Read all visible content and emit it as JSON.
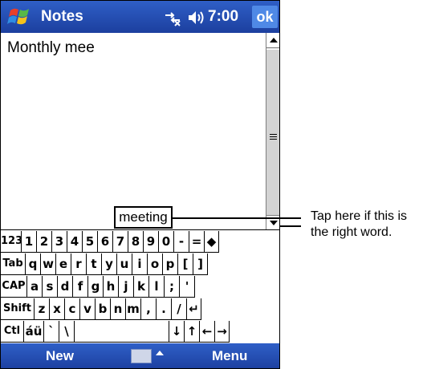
{
  "titlebar": {
    "app_title": "Notes",
    "time": "7:00",
    "ok_label": "ok"
  },
  "note": {
    "text": "Monthly mee"
  },
  "suggestion": {
    "word": "meeting"
  },
  "keyboard": {
    "rows": [
      [
        "123",
        "1",
        "2",
        "3",
        "4",
        "5",
        "6",
        "7",
        "8",
        "9",
        "0",
        "-",
        "=",
        "◆"
      ],
      [
        "Tab",
        "q",
        "w",
        "e",
        "r",
        "t",
        "y",
        "u",
        "i",
        "o",
        "p",
        "[",
        "]"
      ],
      [
        "CAP",
        "a",
        "s",
        "d",
        "f",
        "g",
        "h",
        "j",
        "k",
        "l",
        ";",
        "'"
      ],
      [
        "Shift",
        "z",
        "x",
        "c",
        "v",
        "b",
        "n",
        "m",
        ",",
        ".",
        "/",
        "↵"
      ],
      [
        "Ctl",
        "áü",
        "`",
        "\\",
        " ",
        "↓",
        "↑",
        "←",
        "→"
      ]
    ]
  },
  "menubar": {
    "new_label": "New",
    "menu_label": "Menu"
  },
  "callout": {
    "text": "Tap here if this is the right word."
  },
  "colors": {
    "titlebar": "#2f5fc7",
    "ok_button": "#4f89e6"
  },
  "icons": [
    "windows-start-icon",
    "connectivity-icon",
    "volume-icon",
    "keyboard-icon",
    "scroll-up-arrow-icon",
    "scroll-down-arrow-icon"
  ]
}
